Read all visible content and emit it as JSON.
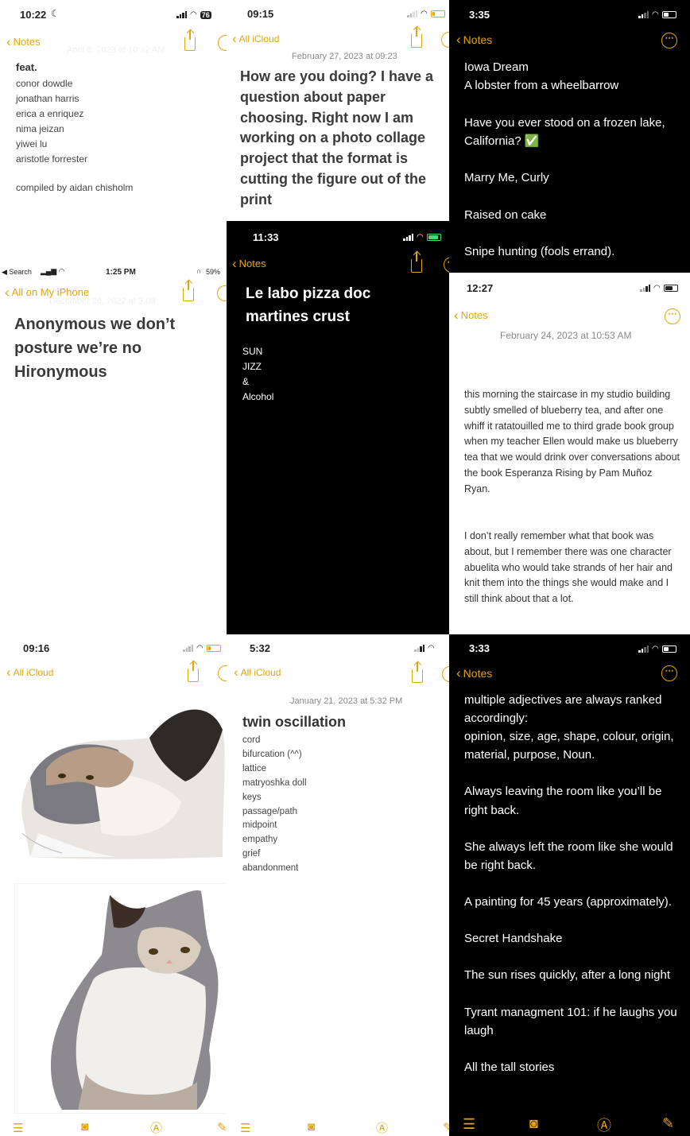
{
  "colors": {
    "accent": "#e2a50d",
    "dark_bg": "#000000",
    "light_bg": "#ffffff"
  },
  "p1": {
    "time": "10:22",
    "battery": "76",
    "back": "Notes",
    "date_ghost": "April 8, 2023 at 10:32 AM",
    "heading": "feat.",
    "lines": "conor dowdle\njonathan harris\nerica a enriquez\nnima jeizan\nyiwei lu\naristotle forrester",
    "footer": "compiled by aidan chisholm"
  },
  "p2": {
    "time": "09:15",
    "back": "All iCloud",
    "date": "February 27, 2023 at 09:23",
    "body": "How are you doing? I have a question about paper choosing. Right now I am working on a photo collage project that the format is cutting the figure out of the print"
  },
  "p3": {
    "time": "3:35",
    "back": "Notes",
    "body": "Iowa Dream\nA lobster from a wheelbarrow\n\nHave you ever stood on a frozen lake, California? ✅\n\nMarry Me, Curly\n\nRaised on cake\n\nSnipe hunting (fools errand)."
  },
  "p4": {
    "carrier": "◀ Search",
    "time": "1:25 PM",
    "battery": "59%",
    "back": "All on My iPhone",
    "date_ghost": "December 26, 2022 at 3:09",
    "title": "Anonymous we don’t posture we’re no Hironymous"
  },
  "p5": {
    "time": "11:33",
    "back": "Notes",
    "title": "Le labo pizza doc martines crust",
    "lines": "SUN\nJIZZ\n&\nAlcohol"
  },
  "p6": {
    "time": "12:27",
    "back": "Notes",
    "date": "February 24, 2023 at 10:53 AM",
    "para1": "this morning the staircase in my studio building subtly smelled of blueberry tea, and after one whiff it ratatouilled me to third grade book group when my teacher Ellen would make us blueberry tea that we would drink over conversations about the book Esperanza Rising by Pam Muñoz Ryan.",
    "para2": "I don’t really remember what that book was about, but I remember there was one character abuelita who would take strands of her hair and knit them into the things she would make and I still think about that a lot."
  },
  "p7": {
    "time": "09:16",
    "back": "All iCloud",
    "images": [
      "cat-photo",
      "cat-photo"
    ]
  },
  "p8": {
    "time": "5:32",
    "back": "All iCloud",
    "date": "January 21, 2023 at 5:32 PM",
    "title": "twin oscillation",
    "items": "cord\nbifurcation (^^)\nlattice\nmatryoshka doll\nkeys\npassage/path\nmidpoint\nempathy\ngrief\nabandonment"
  },
  "p9": {
    "time": "3:33",
    "back": "Notes",
    "body": "multiple adjectives are always ranked accordingly:\nopinion, size, age, shape, colour, origin, material, purpose, Noun.\n\nAlways leaving the room like you’ll be right back.\n\nShe always left the room like she would be right back.\n\nA painting for 45 years (approximately).\n\nSecret Handshake\n\nThe sun rises quickly, after a long night\n\nTyrant managment 101: if he laughs you laugh\n\nAll the tall stories"
  },
  "toolbar_icons": [
    "checklist-icon",
    "camera-icon",
    "pen-icon",
    "compose-icon"
  ]
}
